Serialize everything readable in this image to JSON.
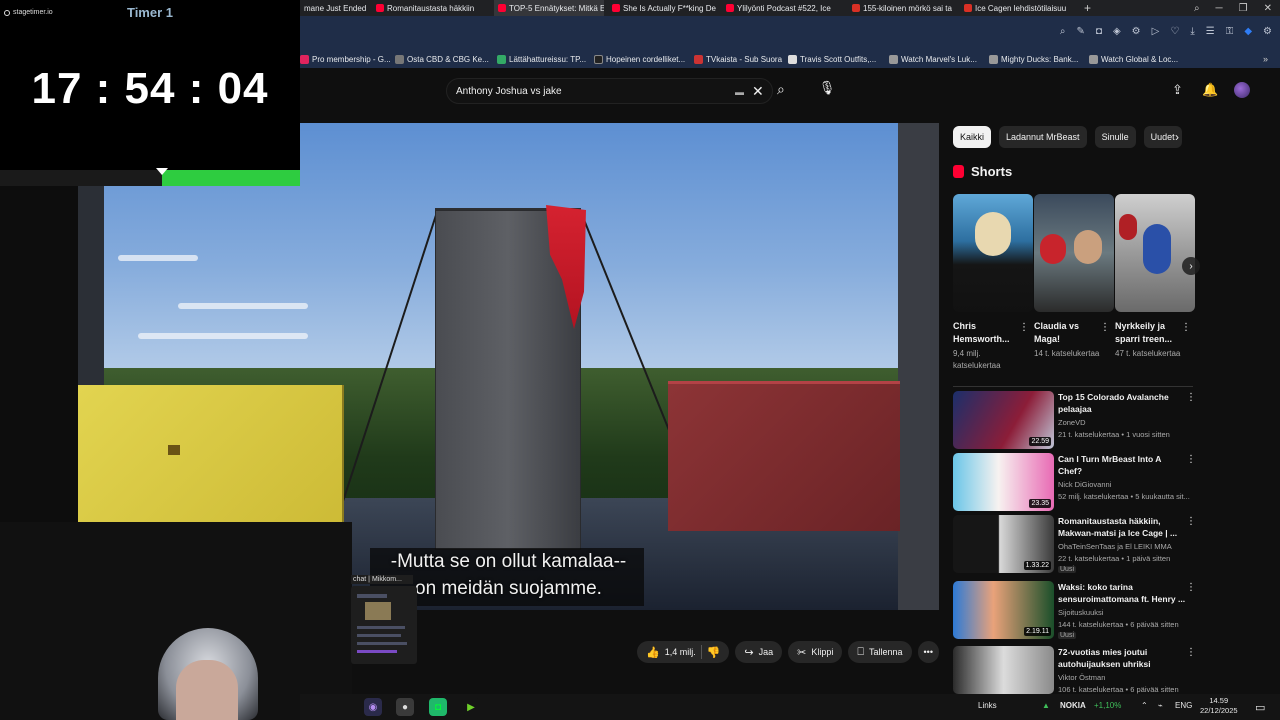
{
  "browser": {
    "tabs": [
      {
        "label": "mane Just Ended |",
        "favicon": "none"
      },
      {
        "label": "Romanitaustasta häkkiin",
        "favicon": "youtube"
      },
      {
        "label": "TOP-5 Ennätykset: Mitkä E",
        "favicon": "youtube"
      },
      {
        "label": "She Is Actually F**king De",
        "favicon": "youtube"
      },
      {
        "label": "Ylilyönti Podcast #522, Ice",
        "favicon": "youtube"
      },
      {
        "label": "155-kiloinen mörkö sai ta",
        "favicon": "news"
      },
      {
        "label": "Ice Cagen lehdistötilaisuu",
        "favicon": "news"
      }
    ],
    "new_tab_label": "+",
    "window_controls": [
      "search-icon",
      "minimize-icon",
      "restore-icon",
      "close-icon"
    ],
    "bookmarks": [
      "Pro membership - G...",
      "Osta CBD & CBG Ke...",
      "Lättähattureissu: TP...",
      "Hopeinen cordelliket...",
      "TVkaista - Sub Suora",
      "Travis Scott Outfits,...",
      "Watch Marvel's Luk...",
      "Mighty Ducks: Bank...",
      "Watch Global & Loc..."
    ],
    "bookmark_more": "»"
  },
  "youtube": {
    "search_value": "Anthony Joshua vs jake",
    "filter_chips": [
      "Kaikki",
      "Ladannut MrBeast",
      "Sinulle",
      "Uudet"
    ],
    "actions": {
      "like_count": "1,4 milj.",
      "share": "Jaa",
      "clip": "Klippi",
      "save": "Tallenna"
    },
    "subtitle_line1": "-Mutta se on ollut kamalaa--",
    "subtitle_line2": "on meidän suojamme.",
    "shorts_heading": "Shorts",
    "shorts": [
      {
        "title": "Chris Hemsworth...",
        "meta": "9,4 milj. katselukertaa"
      },
      {
        "title": "Claudia vs Maga!",
        "meta": "14 t. katselukertaa"
      },
      {
        "title": "Nyrkkeily ja sparri treen...",
        "meta": "47 t. katselukertaa"
      }
    ],
    "videos": [
      {
        "title": "Top 15 Colorado Avalanche pelaajaa",
        "channel": "ZoneVD",
        "meta": "21 t. katselukertaa • 1 vuosi sitten",
        "duration": "22.59",
        "badge": ""
      },
      {
        "title": "Can I Turn MrBeast Into A Chef?",
        "channel": "Nick DiGiovanni",
        "meta": "52 milj. katselukertaa • 5 kuukautta sit...",
        "duration": "23.35",
        "badge": ""
      },
      {
        "title": "Romanitaustasta häkkiin, Makwan-matsi ja Ice Cage | ...",
        "channel": "OhaTeinSenTaas ja El LEIKI MMA",
        "meta": "22 t. katselukertaa • 1 päivä sitten",
        "duration": "1.33.22",
        "badge": "Uusi"
      },
      {
        "title": "Waksi: koko tarina sensuroimattomana ft. Henry ...",
        "channel": "Sijoituskuuksi",
        "meta": "144 t. katselukertaa • 6 päivää sitten",
        "duration": "2.19.11",
        "badge": "Uusi"
      },
      {
        "title": "72-vuotias mies joutui autohuijauksen uhriksi",
        "channel": "Viktor Östman",
        "meta": "106 t. katselukertaa • 6 päivää sitten",
        "duration": "",
        "badge": ""
      }
    ]
  },
  "overlay": {
    "timer_logo": "stagetimer.io",
    "timer_name": "Timer 1",
    "timer_value": "17 : 54 : 04",
    "timer_progress": 0.46,
    "preview_title": "chat | Mikkom..."
  },
  "taskbar": {
    "links_label": "Links",
    "stock_name": "NOKIA",
    "stock_change": "+1,10%",
    "language": "ENG",
    "time": "14.59",
    "date": "22/12/2025"
  },
  "colors": {
    "youtube_red": "#ff0033",
    "timer_green": "#2ecc40",
    "toolbar_blue": "#1f2d48"
  }
}
